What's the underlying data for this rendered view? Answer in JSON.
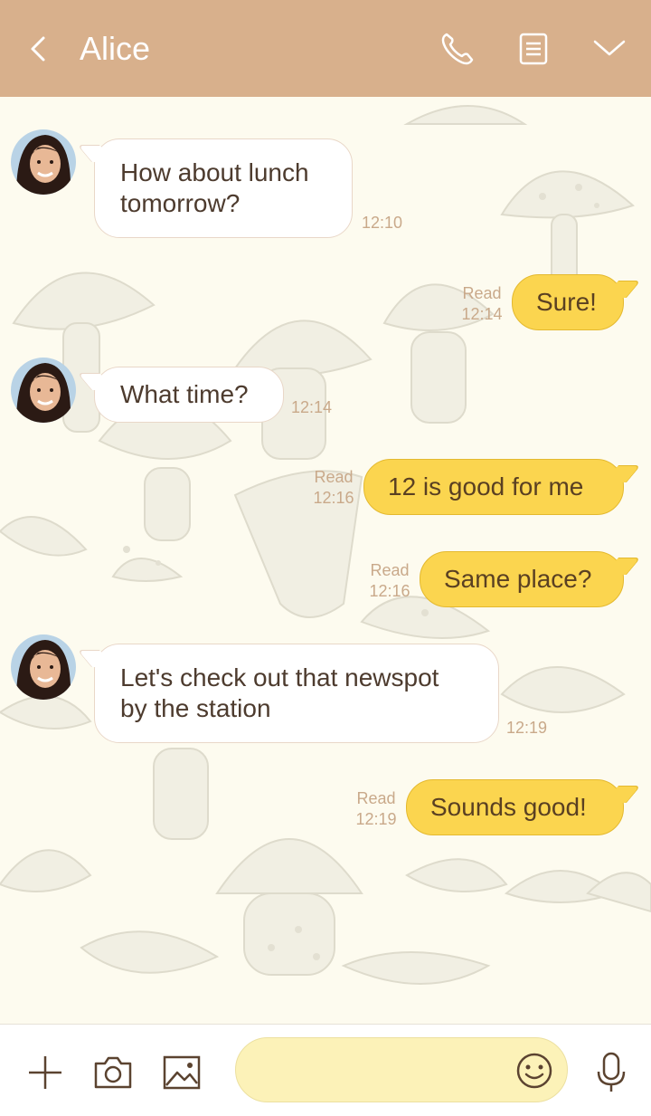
{
  "header": {
    "title": "Alice"
  },
  "colors": {
    "header_bg": "#d8b08c",
    "outgoing_bubble": "#fbd54f",
    "incoming_bubble": "#ffffff",
    "background": "#fdfbef"
  },
  "icons": {
    "back": "chevron-left-icon",
    "call": "phone-icon",
    "notes": "note-icon",
    "menu": "chevron-down-icon",
    "plus": "plus-icon",
    "camera": "camera-icon",
    "image": "image-icon",
    "emoji": "smiley-icon",
    "mic": "microphone-icon"
  },
  "messages": [
    {
      "direction": "in",
      "text_lines": [
        "How about lunch",
        "tomorrow?"
      ],
      "time": "12:10"
    },
    {
      "direction": "out",
      "text": "Sure!",
      "status": "Read",
      "time": "12:14"
    },
    {
      "direction": "in",
      "text_lines": [
        "What time?"
      ],
      "time": "12:14"
    },
    {
      "direction": "out",
      "text": "12 is good for me",
      "status": "Read",
      "time": "12:16"
    },
    {
      "direction": "out",
      "text": "Same place?",
      "status": "Read",
      "time": "12:16"
    },
    {
      "direction": "in",
      "text_lines": [
        "Let's check out that newspot",
        "by the station"
      ],
      "time": "12:19"
    },
    {
      "direction": "out",
      "text": "Sounds good!",
      "status": "Read",
      "time": "12:19"
    }
  ]
}
